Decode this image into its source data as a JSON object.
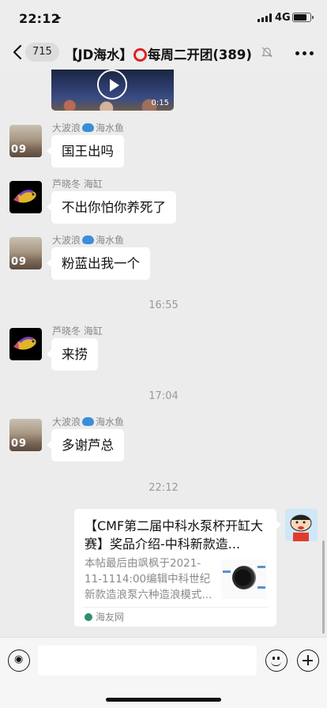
{
  "status_bar": {
    "time": "22:12",
    "network": "4G",
    "battery_level": 0.8
  },
  "nav": {
    "back_count": "715",
    "title_before": "【JD海水】",
    "title_after": "每周二开团(389)"
  },
  "video": {
    "duration": "0:15"
  },
  "messages": [
    {
      "sender_name": "大波浪",
      "sender_tag": "海水鱼",
      "avatar": "wave-avatar",
      "text": "国王出吗"
    },
    {
      "sender_name": "芦晓冬",
      "sender_tag": "海缸",
      "avatar": "fish-avatar",
      "text": "不出你怕你养死了"
    },
    {
      "sender_name": "大波浪",
      "sender_tag": "海水鱼",
      "avatar": "wave-avatar",
      "text": "粉蓝出我一个"
    },
    {
      "sender_name": "芦晓冬",
      "sender_tag": "海缸",
      "avatar": "fish-avatar",
      "text": "来捞"
    },
    {
      "sender_name": "大波浪",
      "sender_tag": "海水鱼",
      "avatar": "wave-avatar",
      "text": "多谢芦总"
    }
  ],
  "avatar_text": "09",
  "timestamps": [
    "16:55",
    "17:04",
    "22:12"
  ],
  "link_card": {
    "title": "【CMF第二届中科水泵杯开缸大赛】奖品介绍-中科新款造...",
    "description": "本帖最后由飒枫于2021-11-1114:00编辑中科世纪新款造浪泵六种造浪模式...",
    "source": "海友网"
  },
  "input": {
    "value": ""
  }
}
